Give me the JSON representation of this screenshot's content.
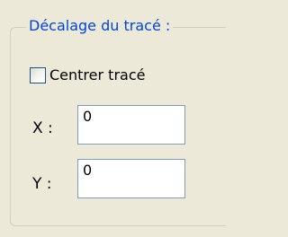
{
  "group": {
    "title": "Décalage du tracé :"
  },
  "center_trace": {
    "label": "Centrer tracé",
    "checked": false
  },
  "x_field": {
    "label": "X :",
    "value": "0"
  },
  "y_field": {
    "label": "Y :",
    "value": "0"
  }
}
